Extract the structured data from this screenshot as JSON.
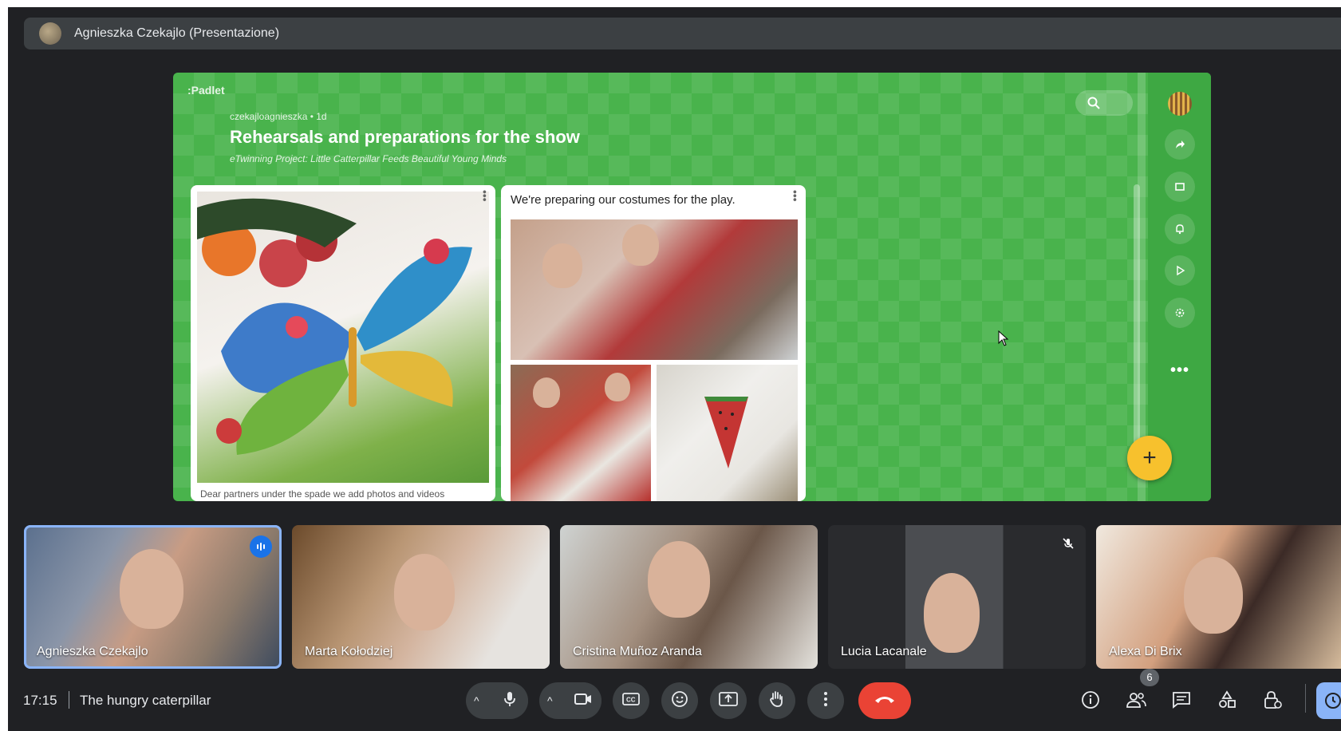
{
  "presenter_bar": {
    "label": "Agnieszka Czekajlo (Presentazione)"
  },
  "padlet": {
    "logo": ":Padlet",
    "author_meta": "czekajloagnieszka • 1d",
    "title": "Rehearsals and preparations for the show",
    "subtitle": "eTwinning Project: Little Catterpillar Feeds Beautiful Young Minds",
    "cards": [
      {
        "caption": "Dear partners under the spade we add photos and videos"
      },
      {
        "text": "We're preparing our costumes for the play."
      }
    ],
    "fab_label": "+",
    "more_label": "•••"
  },
  "participants": [
    {
      "name": "Agnieszka Czekajlo",
      "speaking": true
    },
    {
      "name": "Marta Kołodziej"
    },
    {
      "name": "Cristina Muñoz Aranda"
    },
    {
      "name": "Lucia Lacanale",
      "muted": true
    },
    {
      "name": "Alexa Di Brix"
    }
  ],
  "meeting": {
    "time": "17:15",
    "title": "The hungry caterpillar",
    "people_count": "6"
  },
  "colors": {
    "meet_bg": "#202124",
    "padlet_green": "#49b34c",
    "hangup": "#ea4335",
    "fab": "#f7c12d",
    "accent": "#8ab4f8"
  },
  "icons": {
    "toolbar": [
      "mic-icon",
      "camera-icon",
      "captions-icon",
      "emoji-icon",
      "present-icon",
      "raise-hand-icon",
      "more-options-icon",
      "hangup-icon"
    ],
    "right": [
      "info-icon",
      "people-icon",
      "chat-icon",
      "activities-icon",
      "host-controls-icon",
      "timer-icon"
    ]
  }
}
